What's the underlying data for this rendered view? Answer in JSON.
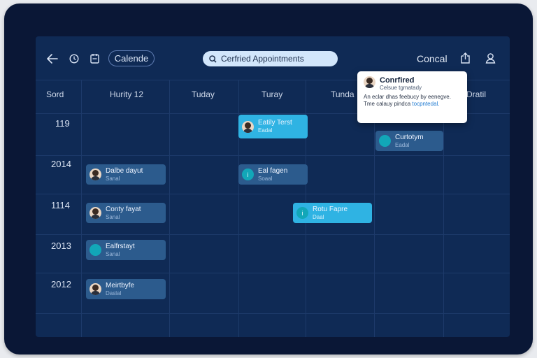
{
  "toolbar": {
    "back_icon": "arrow-left-icon",
    "clock_icon": "clock-icon",
    "calendar_icon": "calendar-icon",
    "view_label": "Calende",
    "search": {
      "icon": "search-icon",
      "value": "Cerfried Appointments"
    },
    "cancel_label": "Concal",
    "share_icon": "share-icon",
    "profile_icon": "profile-icon"
  },
  "header": {
    "corner": "Sord",
    "columns": [
      "Hurity 12",
      "Tuday",
      "Turay",
      "Tunda",
      "Dratil"
    ]
  },
  "rows": [
    "119",
    "2014",
    "1114",
    "2013",
    "2012"
  ],
  "events": [
    {
      "title": "Eatily Terst",
      "sub": "Eadal",
      "avatar": "person"
    },
    {
      "title": "Curtotym",
      "sub": "Eadal",
      "avatar": "person"
    },
    {
      "title": "Dalbe dayut",
      "sub": "Sanal",
      "avatar": "person"
    },
    {
      "title": "Eal fagen",
      "sub": "Soaal",
      "avatar": "teal"
    },
    {
      "title": "Conty fayat",
      "sub": "Sanal",
      "avatar": "person"
    },
    {
      "title": "Rotu Fapre",
      "sub": "Daal",
      "avatar": "teal"
    },
    {
      "title": "Ealfrstayt",
      "sub": "Sanal",
      "avatar": "person"
    },
    {
      "title": "Meirtbyfe",
      "sub": "Daslal",
      "avatar": "person"
    }
  ],
  "popover": {
    "title": "Conrfired",
    "subtitle": "Celsue tgmatady",
    "body": "An eclar dhas feebucy by eenegve. Tme calauy pindca",
    "link": "tocpntedal."
  },
  "colors": {
    "background": "#0f2a55",
    "frame": "#0a1736",
    "event_dark": "#2c5b8d",
    "event_light": "#2fb3e3",
    "search_bg": "#d2e6fb"
  }
}
